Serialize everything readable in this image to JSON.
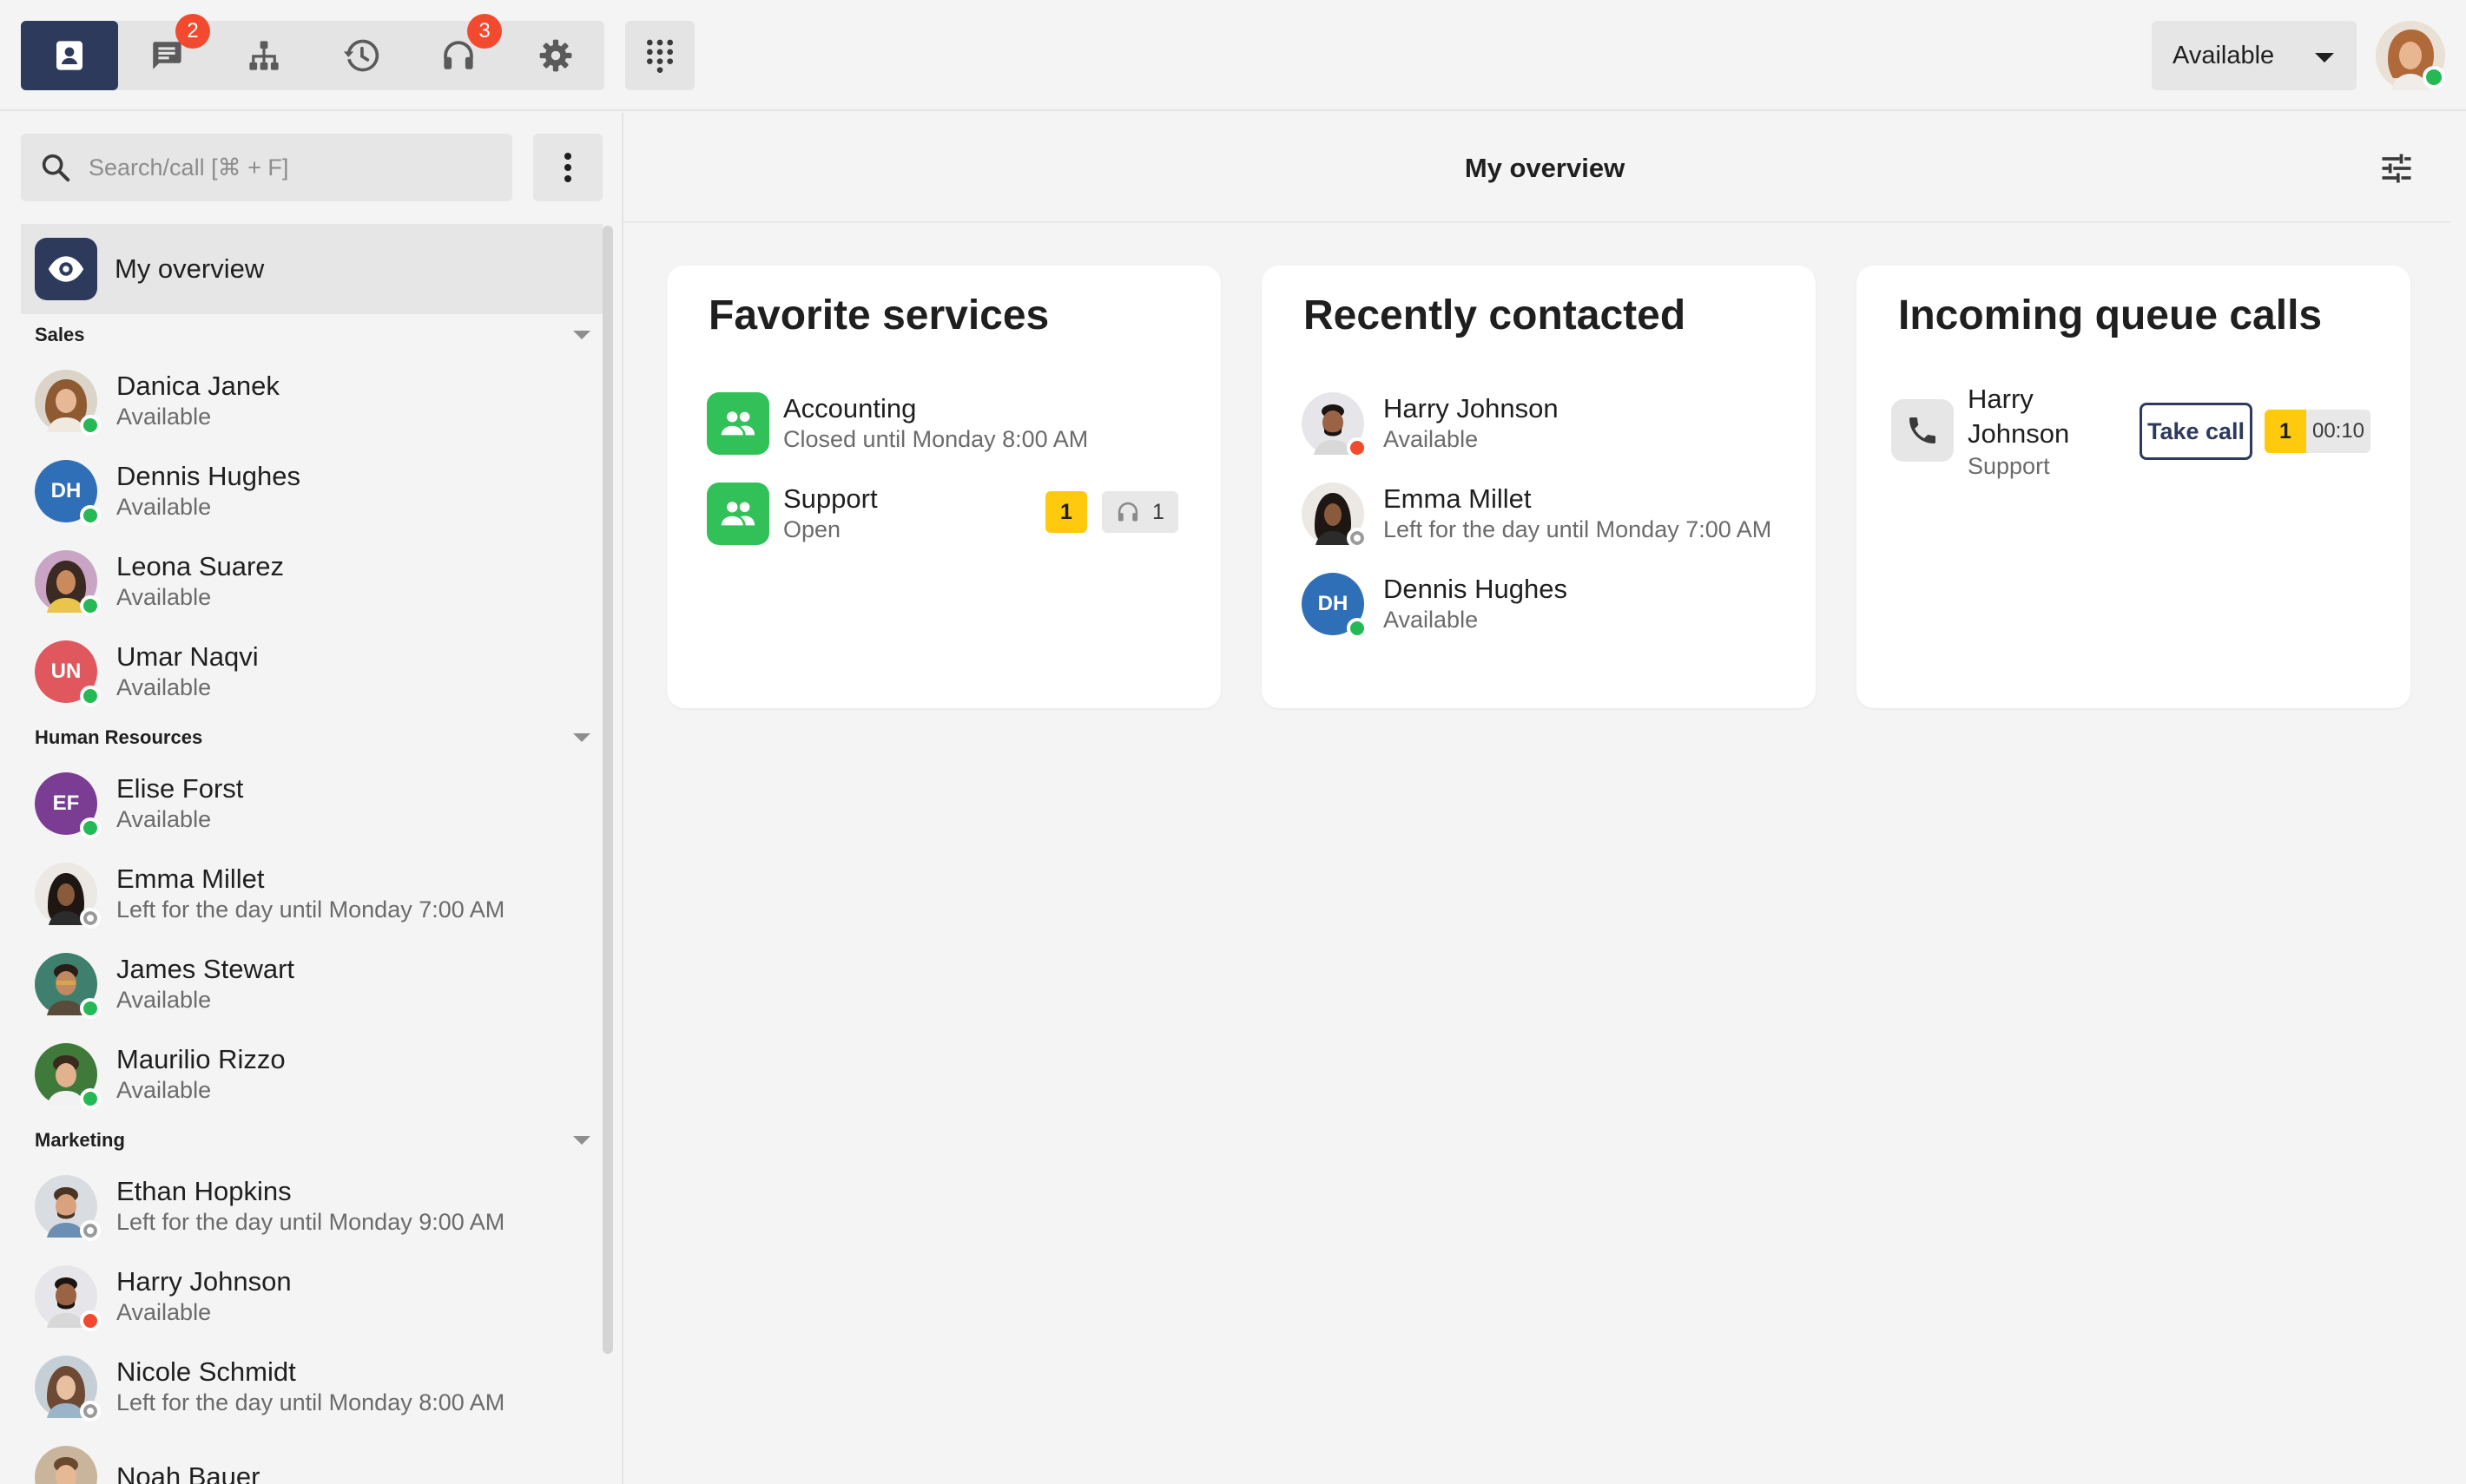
{
  "topbar": {
    "nav": [
      {
        "id": "contacts",
        "icon": "contacts-icon",
        "active": true
      },
      {
        "id": "chat",
        "icon": "chat-icon",
        "badge": "2"
      },
      {
        "id": "org",
        "icon": "org-chart-icon"
      },
      {
        "id": "history",
        "icon": "history-icon"
      },
      {
        "id": "queues",
        "icon": "headset-icon",
        "badge": "3"
      },
      {
        "id": "settings",
        "icon": "gear-icon"
      }
    ],
    "dialpad_icon": "dialpad-icon",
    "status": {
      "selected": "Available"
    }
  },
  "sidebar": {
    "search_placeholder": "Search/call [⌘ + F]",
    "overview_label": "My overview",
    "groups": [
      {
        "name": "Sales",
        "contacts": [
          {
            "name": "Danica Janek",
            "status": "Available",
            "presence": "available"
          },
          {
            "name": "Dennis Hughes",
            "status": "Available",
            "presence": "available",
            "initials": "DH"
          },
          {
            "name": "Leona Suarez",
            "status": "Available",
            "presence": "available"
          },
          {
            "name": "Umar Naqvi",
            "status": "Available",
            "presence": "available",
            "initials": "UN"
          }
        ]
      },
      {
        "name": "Human Resources",
        "contacts": [
          {
            "name": "Elise Forst",
            "status": "Available",
            "presence": "available",
            "initials": "EF"
          },
          {
            "name": "Emma Millet",
            "status": "Left for the day until Monday 7:00 AM",
            "presence": "away"
          },
          {
            "name": "James Stewart",
            "status": "Available",
            "presence": "available"
          },
          {
            "name": "Maurilio Rizzo",
            "status": "Available",
            "presence": "available"
          }
        ]
      },
      {
        "name": "Marketing",
        "contacts": [
          {
            "name": "Ethan Hopkins",
            "status": "Left for the day until Monday 9:00 AM",
            "presence": "away"
          },
          {
            "name": "Harry Johnson",
            "status": "Available",
            "presence": "busy"
          },
          {
            "name": "Nicole Schmidt",
            "status": "Left for the day until Monday 8:00 AM",
            "presence": "away"
          },
          {
            "name": "Noah Bauer",
            "status": "",
            "presence": "available"
          }
        ]
      }
    ]
  },
  "main": {
    "title": "My overview",
    "favorite_services": {
      "title": "Favorite services",
      "items": [
        {
          "name": "Accounting",
          "status": "Closed until Monday 8:00 AM"
        },
        {
          "name": "Support",
          "status": "Open",
          "waiting": "1",
          "agents": "1"
        }
      ]
    },
    "recently_contacted": {
      "title": "Recently contacted",
      "items": [
        {
          "name": "Harry Johnson",
          "status": "Available",
          "presence": "busy"
        },
        {
          "name": "Emma Millet",
          "status": "Left for the day until Monday 7:00 AM",
          "presence": "away"
        },
        {
          "name": "Dennis Hughes",
          "status": "Available",
          "presence": "available",
          "initials": "DH"
        }
      ]
    },
    "incoming_queue_calls": {
      "title": "Incoming queue calls",
      "items": [
        {
          "caller_first": "Harry",
          "caller_last": "Johnson",
          "service": "Support",
          "action": "Take call",
          "position": "1",
          "wait": "00:10"
        }
      ]
    }
  },
  "colors": {
    "accent": "#2d3a5c",
    "available": "#24b955",
    "busy": "#f24a2f",
    "service_green": "#31c158",
    "queue_yellow": "#ffc90e"
  }
}
